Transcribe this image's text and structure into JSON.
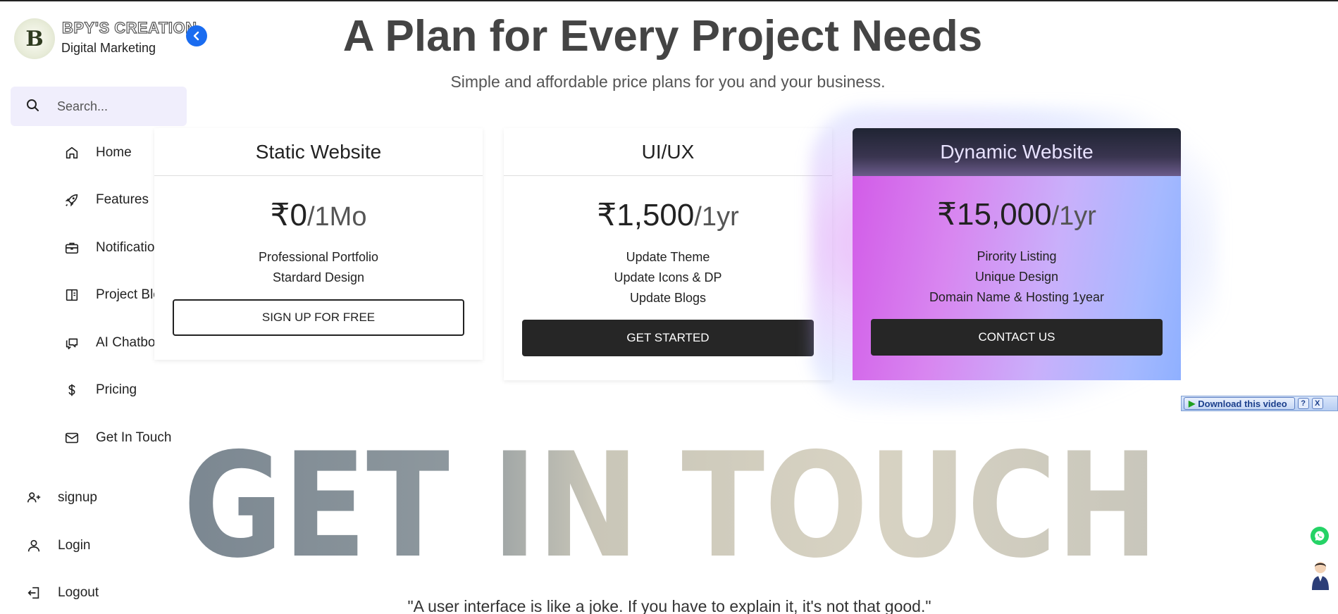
{
  "brand": {
    "logo_letter": "B",
    "title": "BPY'S CREATION",
    "subtitle": "Digital Marketing",
    "collapse_icon": "chevron-left-icon"
  },
  "search": {
    "placeholder": "Search..."
  },
  "nav": [
    {
      "label": "Home",
      "icon": "home-icon"
    },
    {
      "label": "Features",
      "icon": "rocket-icon"
    },
    {
      "label": "Notifications",
      "icon": "briefcase-icon"
    },
    {
      "label": "Project Blog",
      "icon": "book-icon"
    },
    {
      "label": "AI Chatbot",
      "icon": "chat-icon"
    },
    {
      "label": "Pricing",
      "icon": "dollar-icon"
    },
    {
      "label": "Get In Touch",
      "icon": "mail-icon"
    }
  ],
  "account": [
    {
      "label": "signup",
      "icon": "user-plus-icon"
    },
    {
      "label": "Login",
      "icon": "user-icon"
    },
    {
      "label": "Logout",
      "icon": "logout-icon"
    }
  ],
  "header": {
    "title": "A Plan for Every Project Needs",
    "subtitle": "Simple and affordable price plans for you and your business."
  },
  "plans": [
    {
      "name": "Static Website",
      "price": "₹0",
      "period": "/1Mo",
      "features": [
        "Professional Portfolio",
        "Stardard Design"
      ],
      "button": "SIGN UP FOR FREE"
    },
    {
      "name": "UI/UX",
      "price": "₹1,500",
      "period": "/1yr",
      "features": [
        "Update Theme",
        "Update Icons & DP",
        "Update Blogs"
      ],
      "button": "GET STARTED"
    },
    {
      "name": "Dynamic Website",
      "price": "₹15,000",
      "period": "/1yr",
      "features": [
        "Pirority Listing",
        "Unique Design",
        "Domain Name & Hosting 1year"
      ],
      "button": "CONTACT US"
    }
  ],
  "download_bar": {
    "label": "Download this video",
    "help": "?",
    "close": "X"
  },
  "get_in_touch": {
    "text": "GET IN TOUCH"
  },
  "quote": "\"A user interface is like a joke. If you have to explain it, it's not that good.\"",
  "colors": {
    "accent_blue": "#1a6cf0",
    "button_dark": "#262626",
    "search_bg": "#f0eefc",
    "whatsapp": "#25d366"
  }
}
